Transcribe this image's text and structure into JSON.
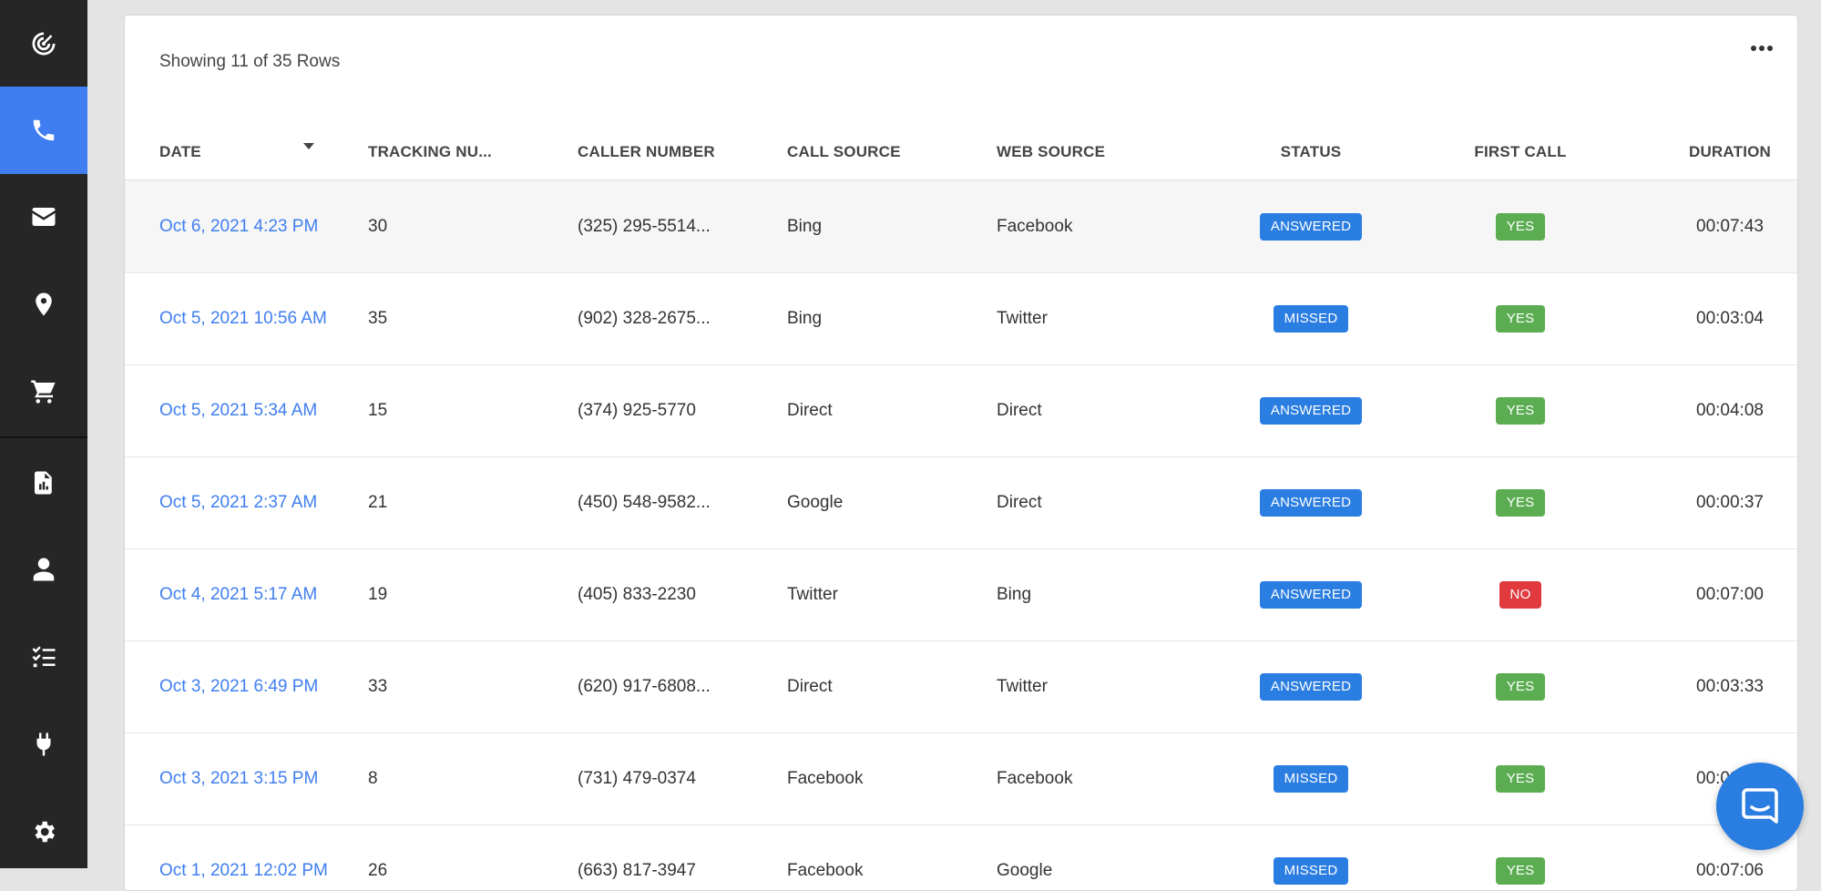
{
  "sidebar": {
    "items": [
      {
        "icon": "radar-icon",
        "label": "Dashboard"
      },
      {
        "icon": "phone-icon",
        "label": "Calls",
        "active": true
      },
      {
        "icon": "envelope-icon",
        "label": "Forms"
      },
      {
        "icon": "location-pin-icon",
        "label": "Locations"
      },
      {
        "icon": "cart-icon",
        "label": "Ecommerce"
      },
      {
        "icon": "report-icon",
        "label": "Reports"
      },
      {
        "icon": "user-icon",
        "label": "Contacts"
      },
      {
        "icon": "checklist-icon",
        "label": "Tasks"
      },
      {
        "icon": "plug-icon",
        "label": "Integrations"
      },
      {
        "icon": "gear-icon",
        "label": "Settings"
      }
    ]
  },
  "table": {
    "row_count_text": "Showing 11 of 35 Rows",
    "columns": [
      "DATE",
      "TRACKING NU...",
      "CALLER NUMBER",
      "CALL SOURCE",
      "WEB SOURCE",
      "STATUS",
      "FIRST CALL",
      "DURATION"
    ],
    "rows": [
      {
        "date": "Oct 6, 2021 4:23 PM",
        "tracking": "30",
        "caller": "(325) 295-5514...",
        "call_source": "Bing",
        "web_source": "Facebook",
        "status": "ANSWERED",
        "first_call": "YES",
        "duration": "00:07:43"
      },
      {
        "date": "Oct 5, 2021 10:56 AM",
        "tracking": "35",
        "caller": "(902) 328-2675...",
        "call_source": "Bing",
        "web_source": "Twitter",
        "status": "MISSED",
        "first_call": "YES",
        "duration": "00:03:04"
      },
      {
        "date": "Oct 5, 2021 5:34 AM",
        "tracking": "15",
        "caller": "(374) 925-5770",
        "call_source": "Direct",
        "web_source": "Direct",
        "status": "ANSWERED",
        "first_call": "YES",
        "duration": "00:04:08"
      },
      {
        "date": "Oct 5, 2021 2:37 AM",
        "tracking": "21",
        "caller": "(450) 548-9582...",
        "call_source": "Google",
        "web_source": "Direct",
        "status": "ANSWERED",
        "first_call": "YES",
        "duration": "00:00:37"
      },
      {
        "date": "Oct 4, 2021 5:17 AM",
        "tracking": "19",
        "caller": "(405) 833-2230",
        "call_source": "Twitter",
        "web_source": "Bing",
        "status": "ANSWERED",
        "first_call": "NO",
        "duration": "00:07:00"
      },
      {
        "date": "Oct 3, 2021 6:49 PM",
        "tracking": "33",
        "caller": "(620) 917-6808...",
        "call_source": "Direct",
        "web_source": "Twitter",
        "status": "ANSWERED",
        "first_call": "YES",
        "duration": "00:03:33"
      },
      {
        "date": "Oct 3, 2021 3:15 PM",
        "tracking": "8",
        "caller": "(731) 479-0374",
        "call_source": "Facebook",
        "web_source": "Facebook",
        "status": "MISSED",
        "first_call": "YES",
        "duration": "00:00:24"
      },
      {
        "date": "Oct 1, 2021 12:02 PM",
        "tracking": "26",
        "caller": "(663) 817-3947",
        "call_source": "Facebook",
        "web_source": "Google",
        "status": "MISSED",
        "first_call": "YES",
        "duration": "00:07:06"
      }
    ]
  },
  "colors": {
    "accent": "#3f7ef0",
    "sidebar_bg": "#262626",
    "badge_blue": "#2a7de1",
    "badge_green": "#5cad52",
    "badge_red": "#e0393e"
  },
  "chat": {
    "icon": "chat-icon"
  }
}
